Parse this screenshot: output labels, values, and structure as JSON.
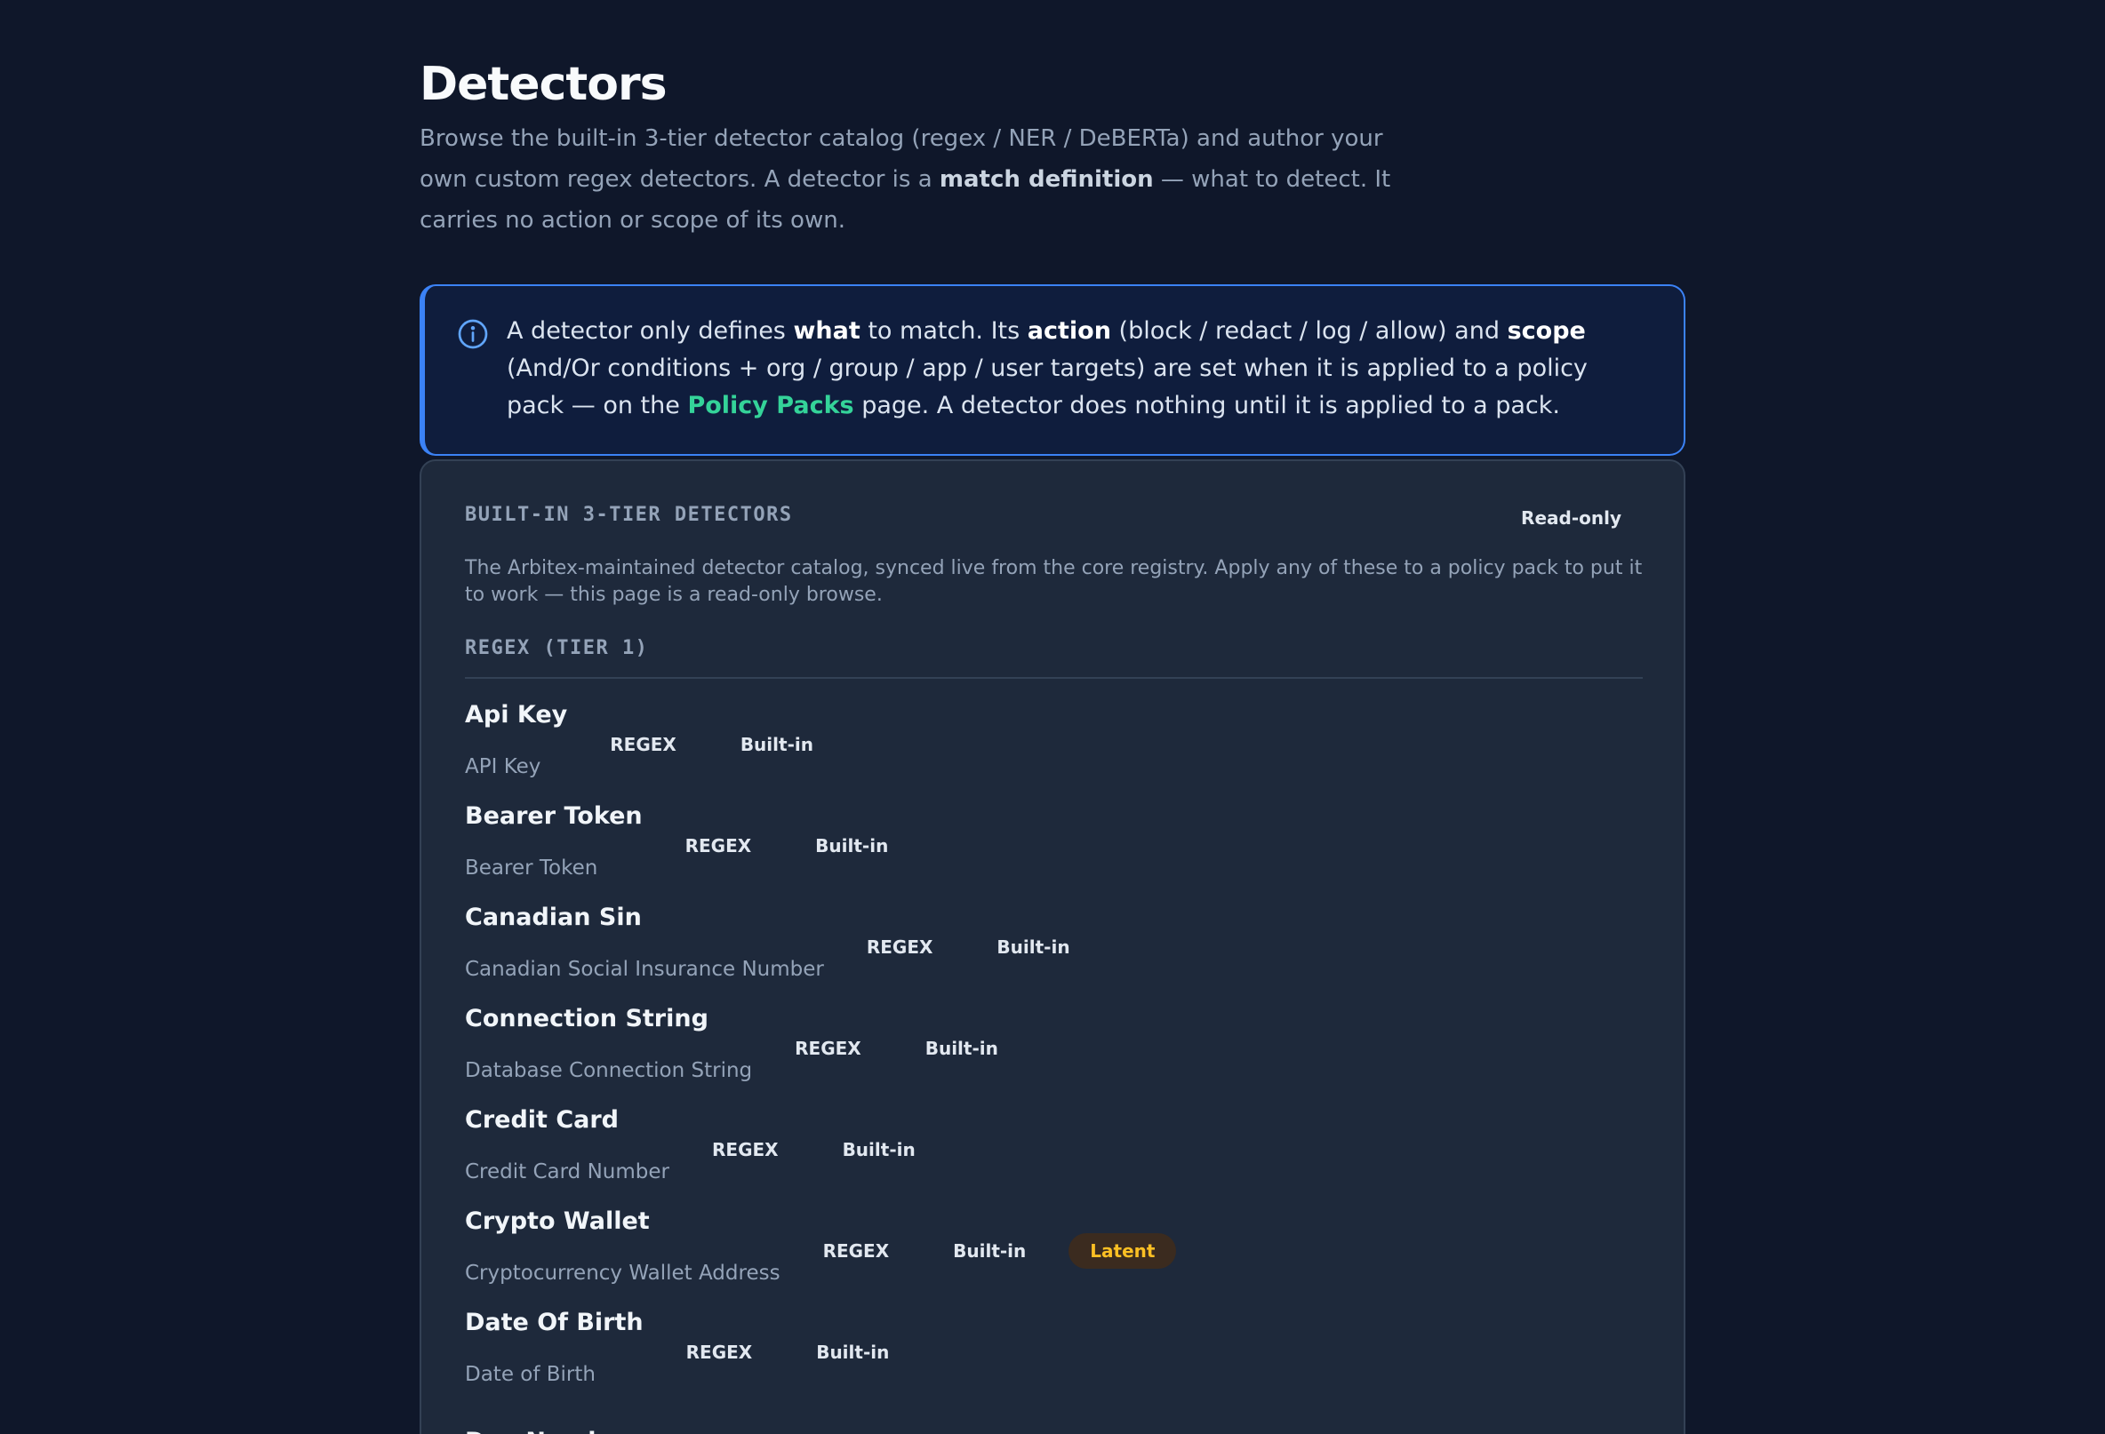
{
  "header": {
    "title": "Detectors",
    "description_parts": {
      "p1": "Browse the built-in 3-tier detector catalog (regex / NER / DeBERTa) and author your own custom regex detectors. A detector is a ",
      "bold": "match definition",
      "p2": " — what to detect. It carries no action or scope of its own."
    }
  },
  "info_banner": {
    "icon": "info-circle-icon",
    "t1": "A detector only defines ",
    "b1": "what",
    "t2": " to match. Its ",
    "b2": "action",
    "t3": " (block / redact / log / allow) and ",
    "b3": "scope",
    "t4": " (And/Or conditions + org / group / app / user targets) are set when it is applied to a policy pack — on the ",
    "link": "Policy Packs",
    "t5": " page. A detector does nothing until it is applied to a pack."
  },
  "catalog": {
    "title": "BUILT-IN 3-TIER DETECTORS",
    "badge": "Read-only",
    "description": "The Arbitex-maintained detector catalog, synced live from the core registry. Apply any of these to a policy pack to put it to work — this page is a read-only browse.",
    "section": "REGEX (TIER 1)",
    "detectors": [
      {
        "name": "Api Key",
        "desc": "API Key",
        "type": "REGEX",
        "origin": "Built-in",
        "status": ""
      },
      {
        "name": "Bearer Token",
        "desc": "Bearer Token",
        "type": "REGEX",
        "origin": "Built-in",
        "status": ""
      },
      {
        "name": "Canadian Sin",
        "desc": "Canadian Social Insurance Number",
        "type": "REGEX",
        "origin": "Built-in",
        "status": ""
      },
      {
        "name": "Connection String",
        "desc": "Database Connection String",
        "type": "REGEX",
        "origin": "Built-in",
        "status": ""
      },
      {
        "name": "Credit Card",
        "desc": "Credit Card Number",
        "type": "REGEX",
        "origin": "Built-in",
        "status": ""
      },
      {
        "name": "Crypto Wallet",
        "desc": "Cryptocurrency Wallet Address",
        "type": "REGEX",
        "origin": "Built-in",
        "status": "Latent"
      },
      {
        "name": "Date Of Birth",
        "desc": "Date of Birth",
        "type": "REGEX",
        "origin": "Built-in",
        "status": ""
      },
      {
        "name": "Dea Number",
        "desc": "",
        "type": "",
        "origin": "",
        "status": ""
      }
    ]
  },
  "colors": {
    "background": "#0f172a",
    "card": "#1e293b",
    "accent_blue": "#3b82f6",
    "link_green": "#34d399",
    "latent_amber": "#fbbf24"
  }
}
